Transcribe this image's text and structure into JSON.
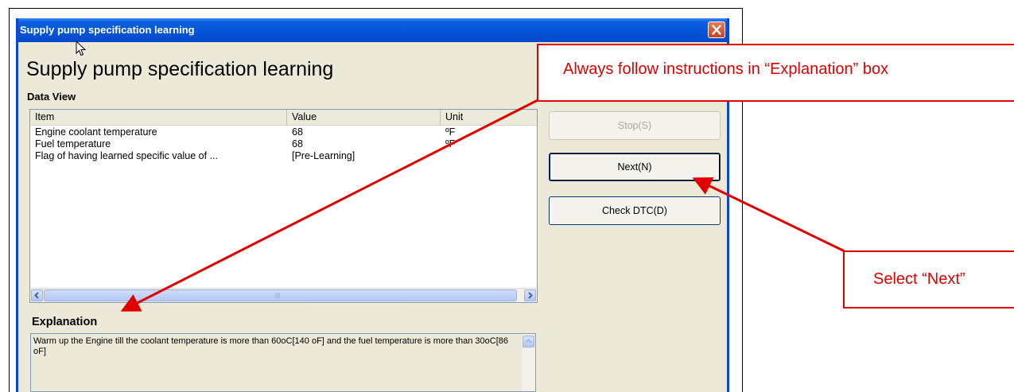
{
  "window": {
    "title": "Supply pump specification learning",
    "heading": "Supply pump specification learning"
  },
  "data_view": {
    "label": "Data View",
    "columns": [
      "Item",
      "Value",
      "Unit"
    ],
    "rows": [
      {
        "item": "Engine coolant temperature",
        "value": "68",
        "unit": "ºF"
      },
      {
        "item": "Fuel temperature",
        "value": "68",
        "unit": "ºF"
      },
      {
        "item": "Flag of having learned specific value of ...",
        "value": "[Pre-Learning]",
        "unit": ""
      }
    ]
  },
  "buttons": {
    "stop": "Stop(S)",
    "next": "Next(N)",
    "check_dtc": "Check DTC(D)"
  },
  "explanation": {
    "label": "Explanation",
    "text": "Warm up the Engine till the coolant temperature is more than 60oC[140 oF] and the fuel temperature is more than 30oC[86 oF]"
  },
  "callouts": {
    "explanation_note": "Always follow instructions in “Explanation” box",
    "next_note": "Select “Next”"
  },
  "colors": {
    "annotation_red": "#e00000",
    "titlebar_blue": "#0553d8",
    "dialog_bg": "#ece9d8"
  },
  "icons": [
    "close-icon",
    "mouse-cursor-icon",
    "scroll-left-icon",
    "scroll-right-icon",
    "scroll-up-icon"
  ]
}
